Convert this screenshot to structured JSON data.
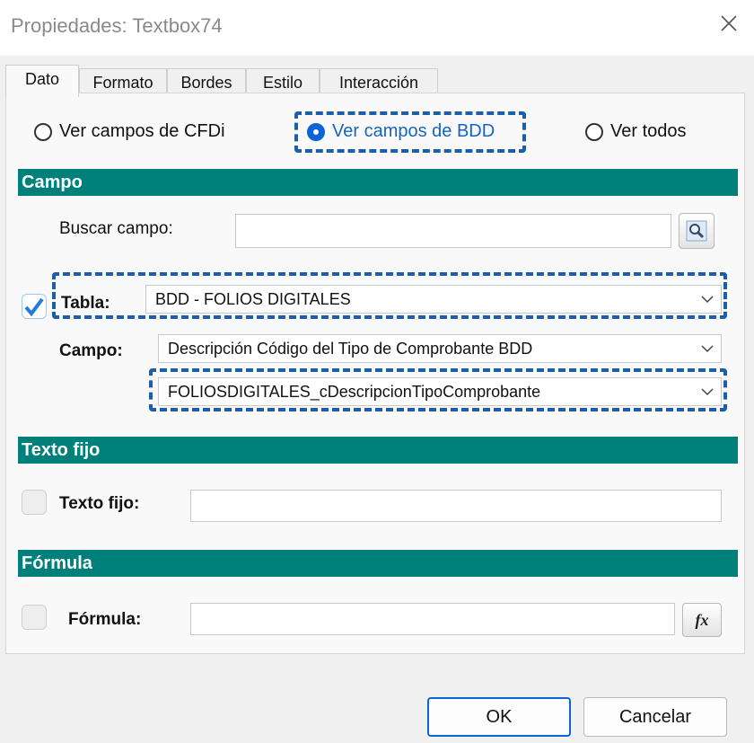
{
  "window": {
    "title": "Propiedades: Textbox74"
  },
  "tabs": [
    {
      "label": "Dato",
      "active": true
    },
    {
      "label": "Formato",
      "active": false
    },
    {
      "label": "Bordes",
      "active": false
    },
    {
      "label": "Estilo",
      "active": false
    },
    {
      "label": "Interacción",
      "active": false
    }
  ],
  "source_options": [
    {
      "label": "Ver campos de CFDi",
      "checked": false
    },
    {
      "label": "Ver campos de BDD",
      "checked": true
    },
    {
      "label": "Ver todos",
      "checked": false
    }
  ],
  "campo_section": {
    "header": "Campo",
    "search_label": "Buscar campo:",
    "search_value": "",
    "search_icon": "magnifier-icon",
    "tabla_label": "Tabla:",
    "tabla_checked": true,
    "tabla_value": "BDD - FOLIOS DIGITALES",
    "campo_label": "Campo:",
    "campo_value": "Descripción Código del Tipo de Comprobante BDD",
    "campo_field_value": "FOLIOSDIGITALES_cDescripcionTipoComprobante"
  },
  "texto_fijo_section": {
    "header": "Texto fijo",
    "label": "Texto fijo:",
    "checked": false,
    "value": ""
  },
  "formula_section": {
    "header": "Fórmula",
    "label": "Fórmula:",
    "checked": false,
    "value": "",
    "fx_label": "fx"
  },
  "buttons": {
    "ok": "OK",
    "cancel": "Cancelar"
  },
  "colors": {
    "section_header": "#00807a",
    "accent": "#0a64d8",
    "highlight": "#1a5fa8"
  }
}
